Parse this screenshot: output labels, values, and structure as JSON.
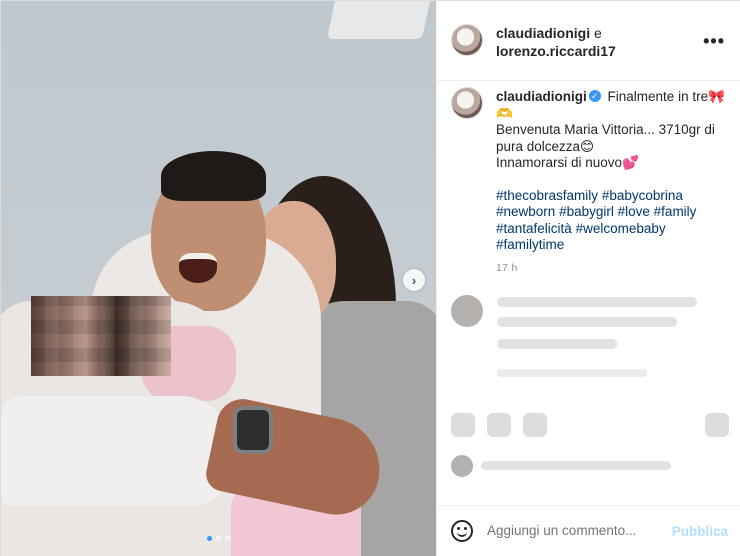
{
  "header": {
    "user1": "claudiadionigi",
    "conjunction": "e",
    "user2": "lorenzo.riccardi17",
    "more_glyph": "•••"
  },
  "caption": {
    "username": "claudiadionigi",
    "line1": "Finalmente in tre🎀",
    "line2": "🫶",
    "line3": "Benvenuta Maria Vittoria... 3710gr di pura dolcezza😊",
    "line4": "Innamorarsi di nuovo💕",
    "hashtags": [
      "#thecobrasfamily",
      "#babycobrina",
      "#newborn",
      "#babygirl",
      "#love",
      "#family",
      "#tantafelicità",
      "#welcomebaby",
      "#familytime"
    ],
    "time": "17 h"
  },
  "carousel": {
    "next_glyph": "›",
    "dot_count": 3,
    "active_dot": 0
  },
  "comment_box": {
    "placeholder": "Aggiungi un commento...",
    "publish_label": "Pubblica"
  },
  "colors": {
    "accent": "#3897f0",
    "publish_disabled": "#b2dffc",
    "hashtag": "#00376b"
  }
}
